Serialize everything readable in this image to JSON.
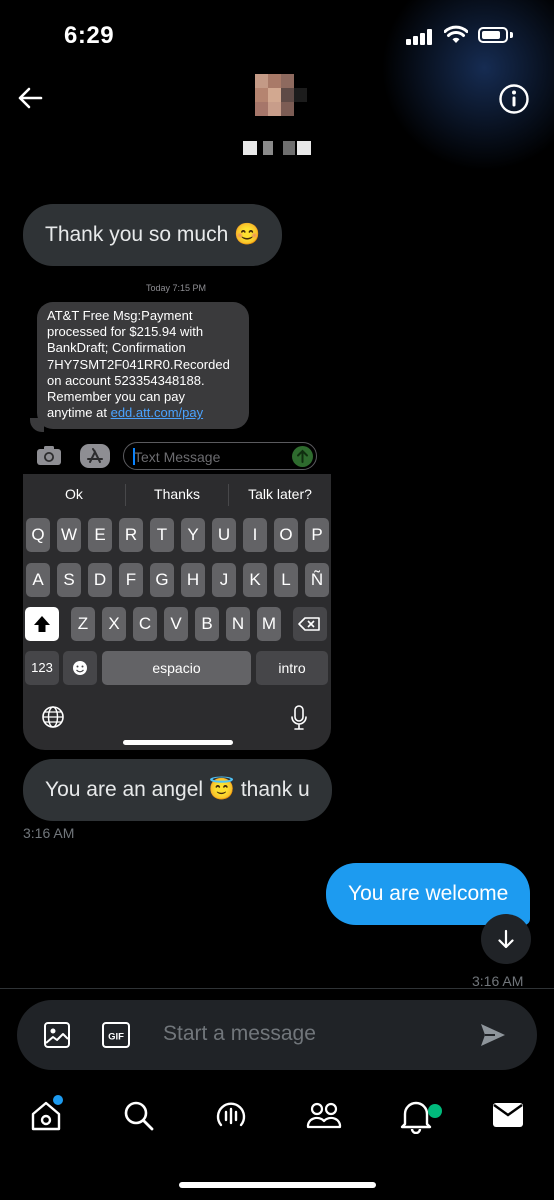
{
  "status_bar": {
    "time": "6:29"
  },
  "thread": {
    "messages": [
      {
        "text": "Thank you so much 😊"
      },
      {
        "text": "You are an angel 😇 thank u",
        "time": "3:16 AM"
      },
      {
        "text": "You are welcome",
        "time": "3:16 AM"
      }
    ]
  },
  "shared_screenshot": {
    "timestamp": "Today 7:15 PM",
    "sms_lines": [
      "AT&T Free Msg:Payment",
      "processed for $215.94 with",
      "BankDraft; Confirmation",
      "7HY7SMT2F041RR0.Recorded",
      "on account 523354348188.",
      "Remember you can pay"
    ],
    "sms_last_prefix": "anytime at ",
    "sms_link": "edd.att.com/pay",
    "input_placeholder": "Text Message",
    "suggestions": [
      "Ok",
      "Thanks",
      "Talk later?"
    ],
    "row1": [
      "Q",
      "W",
      "E",
      "R",
      "T",
      "Y",
      "U",
      "I",
      "O",
      "P"
    ],
    "row2": [
      "A",
      "S",
      "D",
      "F",
      "G",
      "H",
      "J",
      "K",
      "L",
      "Ñ"
    ],
    "row3": [
      "Z",
      "X",
      "C",
      "V",
      "B",
      "N",
      "M"
    ],
    "numbers_key": "123",
    "space_key": "espacio",
    "return_key": "intro"
  },
  "composer": {
    "placeholder": "Start a message"
  },
  "colors": {
    "accent": "#1d9bf0",
    "incoming_bubble": "#2f3336",
    "notification_dot": "#1d9bf0",
    "bell_dot": "#00ba7c"
  }
}
